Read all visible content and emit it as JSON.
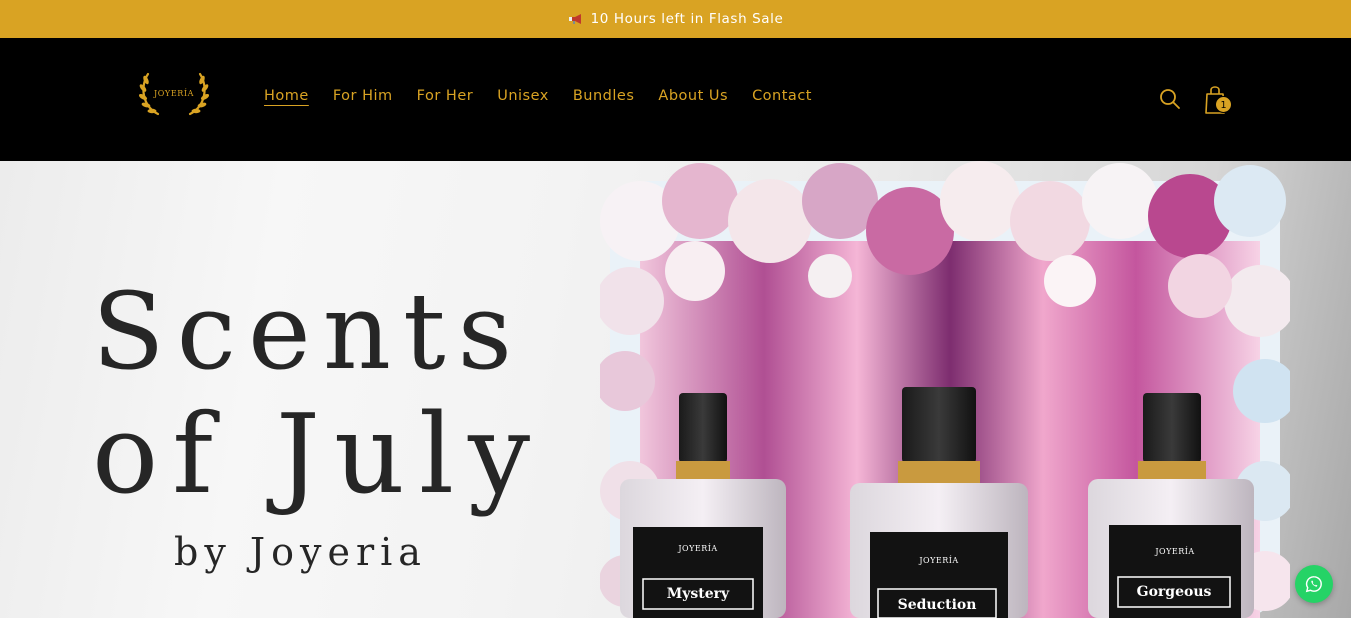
{
  "announcement": {
    "text": "10 Hours left in Flash Sale",
    "icon": "megaphone-icon"
  },
  "header": {
    "logo_text": "JOYERÍA",
    "nav": [
      {
        "label": "Home",
        "active": true
      },
      {
        "label": "For Him",
        "active": false
      },
      {
        "label": "For Her",
        "active": false
      },
      {
        "label": "Unisex",
        "active": false
      },
      {
        "label": "Bundles",
        "active": false
      },
      {
        "label": "About Us",
        "active": false
      },
      {
        "label": "Contact",
        "active": false
      }
    ],
    "search_icon": "search-icon",
    "cart_icon": "shopping-bag-icon",
    "cart_count": "1"
  },
  "hero": {
    "line1": "Scents",
    "line2": "of July",
    "line3": "by Joyeria",
    "bottles": [
      {
        "brand": "JOYERÍA",
        "name": "Mystery"
      },
      {
        "brand": "JOYERÍA",
        "name": "Seduction"
      },
      {
        "brand": "JOYERÍA",
        "name": "Gorgeous"
      }
    ]
  },
  "floating": {
    "whatsapp_icon": "whatsapp-icon"
  },
  "colors": {
    "accent": "#d9a323",
    "header_bg": "#000000",
    "whatsapp": "#25d366"
  }
}
